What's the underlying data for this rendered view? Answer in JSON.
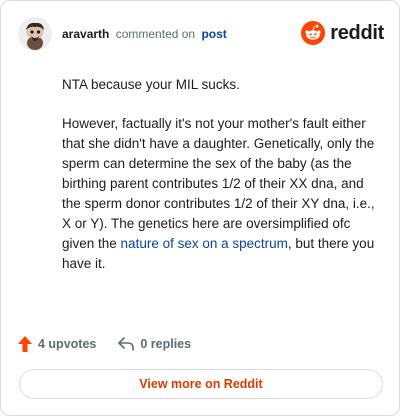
{
  "header": {
    "username": "aravarth",
    "verb": "commented on",
    "target": "post",
    "brand": "reddit"
  },
  "comment": {
    "p1": "NTA because your MIL sucks.",
    "p2_before": "However, factually it's not your mother's fault either that she didn't have a daughter. Genetically, only the sperm can determine the sex of the baby (as the birthing parent contributes 1/2 of their XX dna, and the sperm donor contributes 1/2 of their XY dna, i.e., X or Y). The genetics here are oversimplified ofc given the ",
    "p2_link": "nature of sex on a spectrum",
    "p2_after": ", but there you have it."
  },
  "actions": {
    "upvotes_label": "4 upvotes",
    "replies_label": "0 replies"
  },
  "footer": {
    "view_more_label": "View more on Reddit"
  },
  "colors": {
    "reddit_orange": "#ff4500",
    "link_blue": "#0a449b",
    "muted": "#576f76",
    "cta_text": "#d93a00"
  },
  "icons": {
    "avatar": "snoo-avatar",
    "brand": "reddit-logo-icon",
    "upvote": "upvote-arrow-icon",
    "reply": "reply-arrow-icon"
  }
}
